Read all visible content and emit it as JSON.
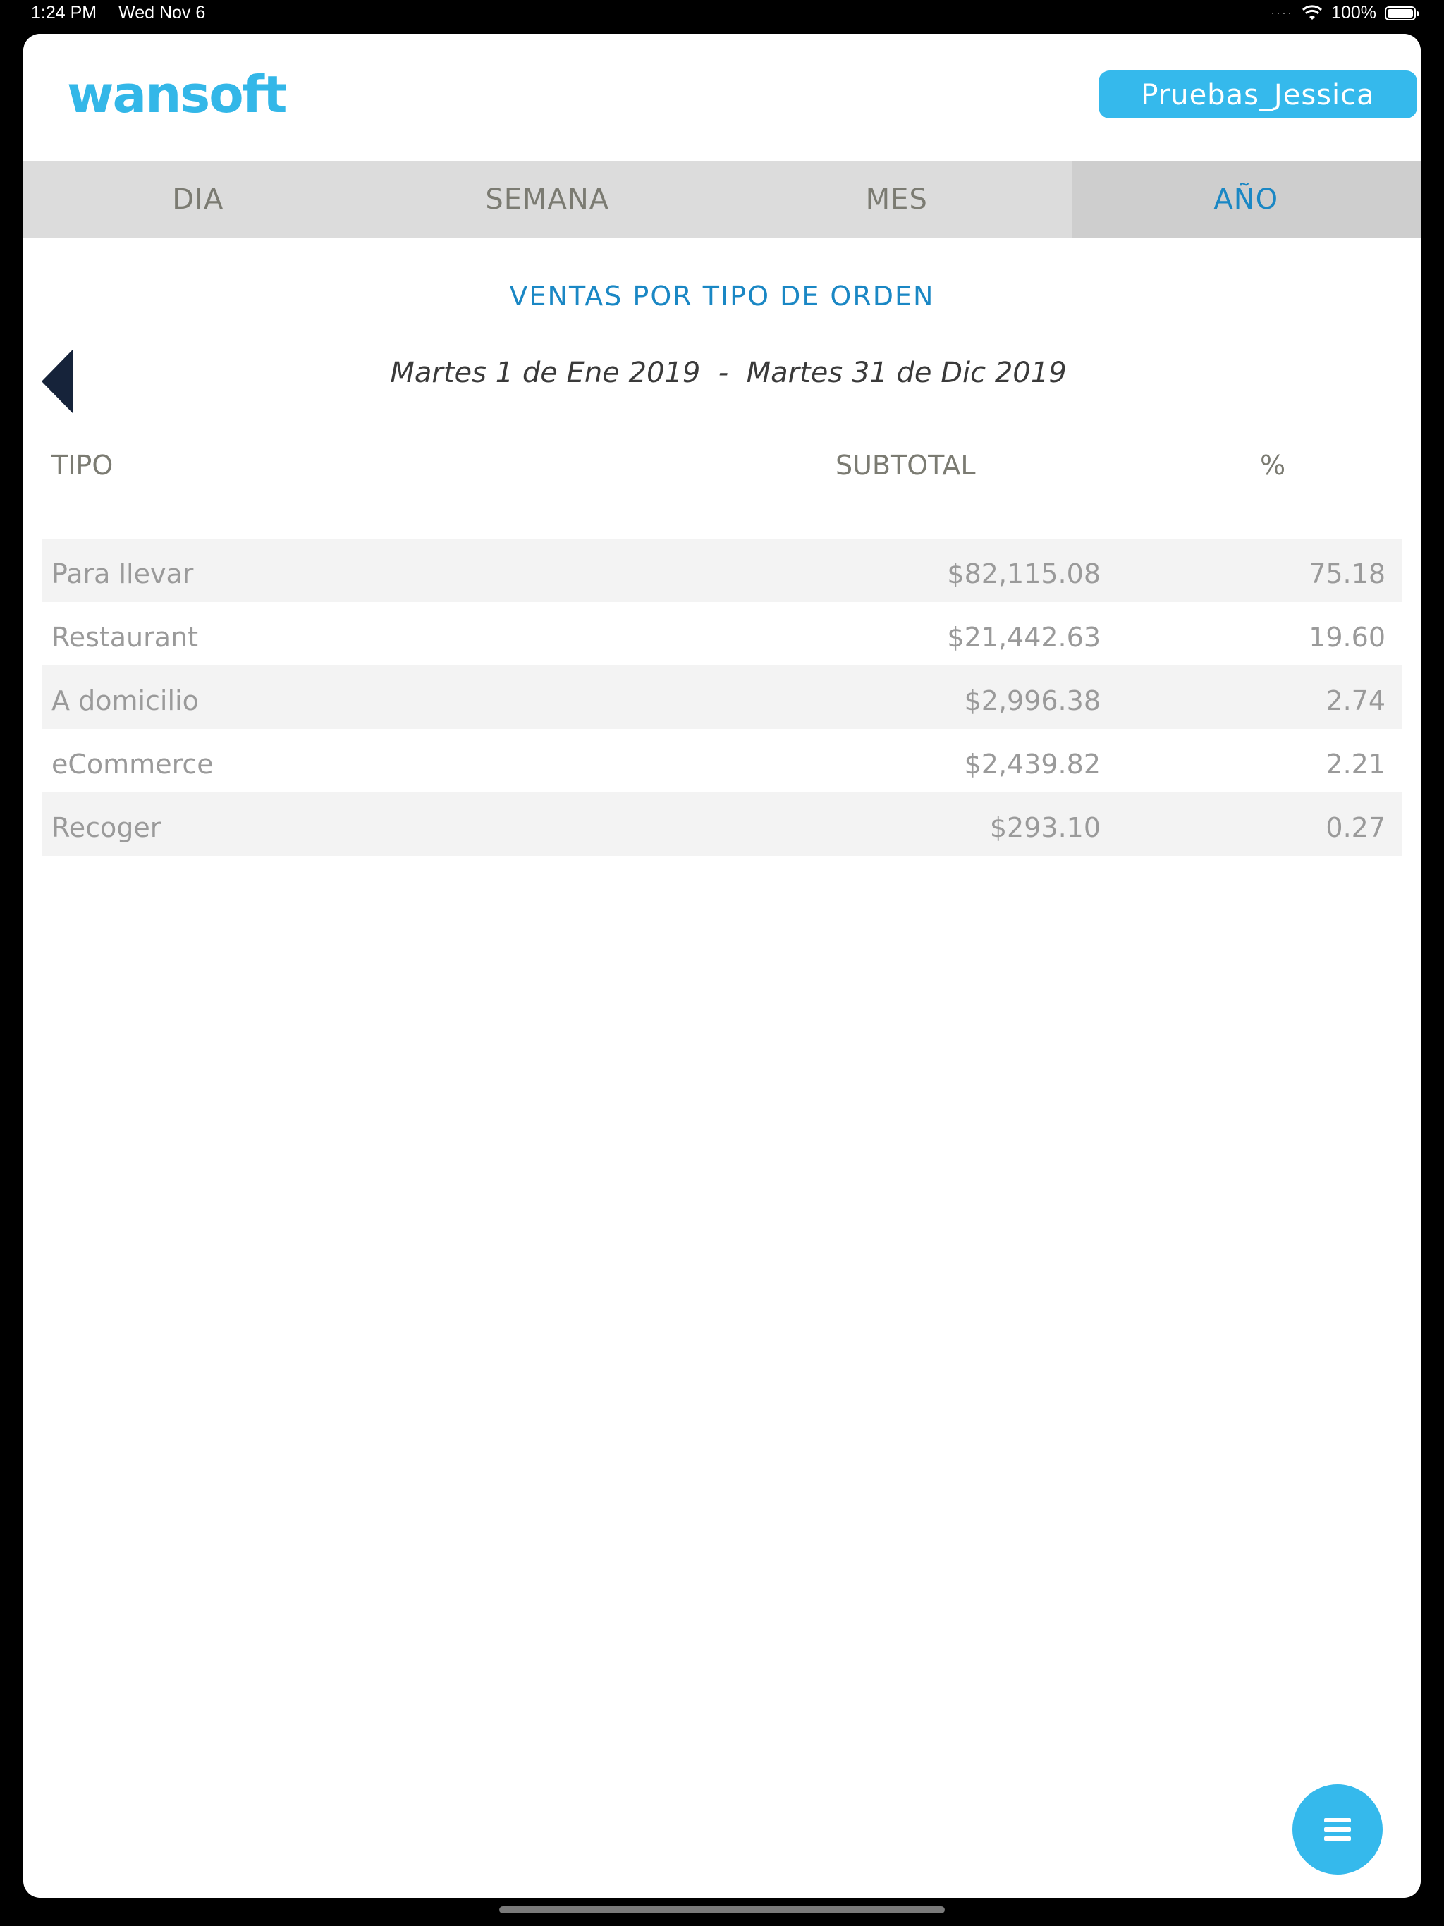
{
  "status_bar": {
    "time": "1:24 PM",
    "date": "Wed Nov 6",
    "battery": "100%"
  },
  "header": {
    "logo": "wansoft",
    "user_button": "Pruebas_Jessica"
  },
  "tabs": [
    {
      "label": "DIA",
      "active": false
    },
    {
      "label": "SEMANA",
      "active": false
    },
    {
      "label": "MES",
      "active": false
    },
    {
      "label": "AÑO",
      "active": true
    }
  ],
  "report": {
    "title": "VENTAS POR TIPO DE ORDEN",
    "date_range": "Martes 1 de Ene 2019  -  Martes 31 de Dic 2019",
    "columns": {
      "tipo": "TIPO",
      "subtotal": "SUBTOTAL",
      "pct": "%"
    },
    "rows": [
      {
        "tipo": "Para llevar",
        "subtotal": "$82,115.08",
        "pct": "75.18"
      },
      {
        "tipo": "Restaurant",
        "subtotal": "$21,442.63",
        "pct": "19.60"
      },
      {
        "tipo": "A domicilio",
        "subtotal": "$2,996.38",
        "pct": "2.74"
      },
      {
        "tipo": "eCommerce",
        "subtotal": "$2,439.82",
        "pct": "2.21"
      },
      {
        "tipo": "Recoger",
        "subtotal": "$293.10",
        "pct": "0.27"
      }
    ]
  },
  "icons": {
    "prev": "chevron-left-icon",
    "menu": "menu-icon",
    "wifi": "wifi-icon",
    "battery": "battery-icon"
  },
  "colors": {
    "accent": "#35b9ec",
    "active_tab_text": "#1a87c4",
    "tab_bar": "#dcdcdc",
    "active_tab_bg": "#cecece",
    "arrow": "#16233a"
  }
}
